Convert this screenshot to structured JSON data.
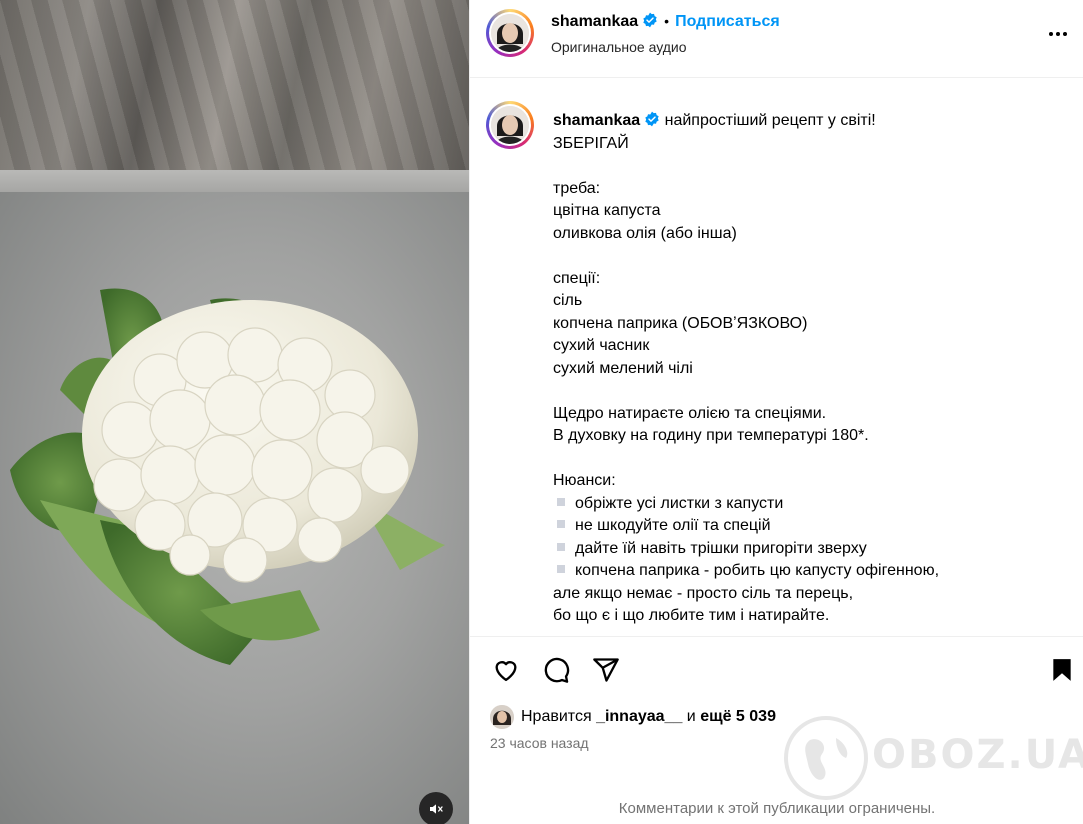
{
  "media": {
    "mute_icon": "speaker-muted-icon"
  },
  "header": {
    "username": "shamankaa",
    "verified_icon": "verified-badge-icon",
    "separator": "•",
    "follow_label": "Подписаться",
    "audio_label": "Оригинальное аудио",
    "more_icon": "more-options-icon"
  },
  "caption": {
    "username": "shamankaa",
    "first_line": "найпростіший рецепт у світі!",
    "lines": [
      "ЗБЕРІГАЙ",
      "",
      "треба:",
      "цвітна капуста",
      "оливкова олія (або інша)",
      "",
      "спеції:",
      "сіль",
      "копчена паприка (ОБОВʼЯЗКОВО)",
      "сухий часник",
      "сухий мелений чілі",
      "",
      "Щедро натираєте олією та спеціями.",
      "В духовку на годину при температурі 180*.",
      "",
      "Нюанси:"
    ],
    "bullets": [
      "обріжте усі листки з капусти",
      "не шкодуйте олії та спецій",
      "дайте їй навіть трішки пригоріти зверху",
      "копчена паприка - робить цю капусту офігенною,"
    ],
    "tail_lines": [
      "але якщо немає - просто сіль та перець,",
      "бо що є і що любите тим і натирайте."
    ]
  },
  "actions": {
    "like_icon": "heart-icon",
    "comment_icon": "comment-icon",
    "share_icon": "share-icon",
    "save_icon": "bookmark-icon"
  },
  "likes": {
    "prefix": "Нравится",
    "liker": "_innayaa__",
    "conjunction": "и",
    "others": "ещё 5 039"
  },
  "timestamp": "23 часов назад",
  "comments_limited": "Комментарии к этой публикации ограничены.",
  "watermark": "OBOZ.UA",
  "colors": {
    "accent": "#0095f6",
    "muted_text": "#737373",
    "verified": "#0095f6"
  }
}
